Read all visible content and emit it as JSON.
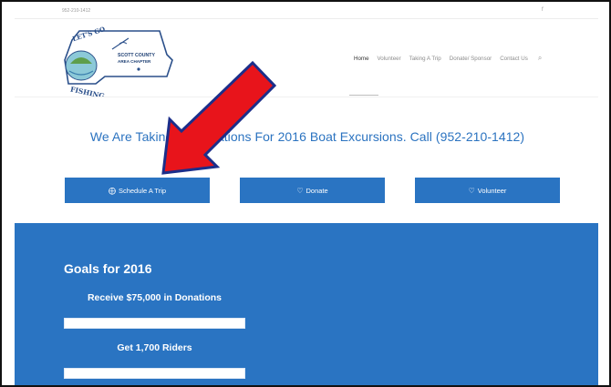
{
  "topbar": {
    "phone": "952-210-1412",
    "social_icon": "facebook-icon"
  },
  "logo": {
    "text_top": "LET'S GO",
    "text_name_1": "SCOTT COUNTY",
    "text_name_2": "AREA CHAPTER",
    "text_bottom": "FISHING"
  },
  "nav": {
    "items": [
      {
        "label": "Home",
        "active": true
      },
      {
        "label": "Volunteer"
      },
      {
        "label": "Taking A Trip"
      },
      {
        "label": "Donate/ Sponsor"
      },
      {
        "label": "Contact Us"
      }
    ],
    "search_icon": "search-icon"
  },
  "headline": "We Are Taking Reservations For 2016 Boat Excursions. Call (952-210-1412)",
  "buttons": {
    "schedule": {
      "label": "Schedule A Trip",
      "icon": "calendar-plus-icon"
    },
    "donate": {
      "label": "Donate",
      "icon": "heart-icon"
    },
    "volunteer": {
      "label": "Volunteer",
      "icon": "heart-icon"
    }
  },
  "goals": {
    "title": "Goals for 2016",
    "items": [
      {
        "label": "Receive $75,000 in Donations",
        "progress": 0
      },
      {
        "label": "Get 1,700 Riders",
        "progress": 0
      }
    ]
  },
  "annotation": {
    "color": "#e8141b",
    "type": "arrow"
  },
  "colors": {
    "brand_blue": "#2a74c2",
    "headline_blue": "#2b73c0"
  }
}
